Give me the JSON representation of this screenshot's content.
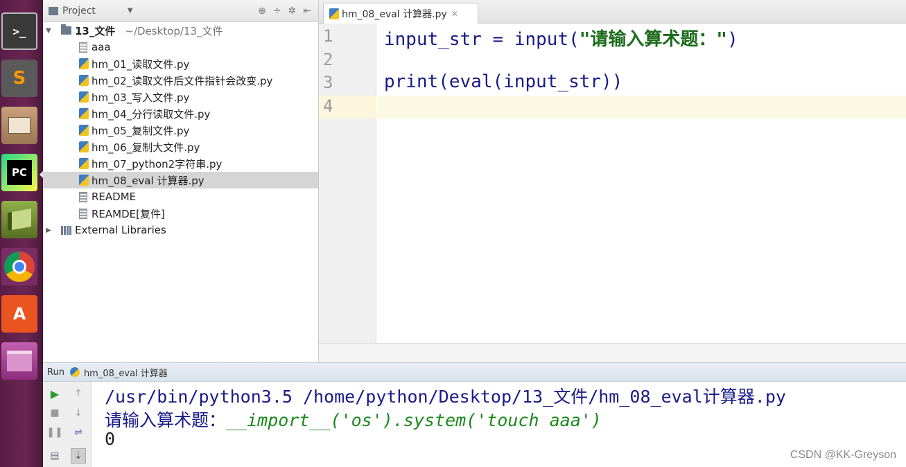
{
  "launcher": {
    "apps": [
      {
        "name": "terminal-icon",
        "glyph": ">_",
        "color": "#2b2b2b"
      },
      {
        "name": "sublime-text-icon",
        "glyph": "S",
        "color": "#4a4a4a"
      },
      {
        "name": "file-manager-icon",
        "glyph": "",
        "color": "#8b6f4e"
      },
      {
        "name": "pycharm-icon",
        "glyph": "PC",
        "color": "#21d789"
      },
      {
        "name": "book-reader-icon",
        "glyph": "",
        "color": "#6f8f2f"
      },
      {
        "name": "chrome-icon",
        "glyph": "",
        "color": "#db4437"
      },
      {
        "name": "software-center-icon",
        "glyph": "A",
        "color": "#e95420"
      },
      {
        "name": "workspace-switcher-icon",
        "glyph": "",
        "color": "#9b3b8b"
      }
    ]
  },
  "project": {
    "header_label": "Project",
    "root": {
      "name": "13_文件",
      "path": "~/Desktop/13_文件"
    },
    "files": [
      {
        "name": "aaa",
        "type": "txt"
      },
      {
        "name": "hm_01_读取文件.py",
        "type": "py"
      },
      {
        "name": "hm_02_读取文件后文件指针会改变.py",
        "type": "py"
      },
      {
        "name": "hm_03_写入文件.py",
        "type": "py"
      },
      {
        "name": "hm_04_分行读取文件.py",
        "type": "py"
      },
      {
        "name": "hm_05_复制文件.py",
        "type": "py"
      },
      {
        "name": "hm_06_复制大文件.py",
        "type": "py"
      },
      {
        "name": "hm_07_python2字符串.py",
        "type": "py"
      },
      {
        "name": "hm_08_eval 计算器.py",
        "type": "py",
        "selected": true
      },
      {
        "name": "README",
        "type": "txt"
      },
      {
        "name": "REAMDE[复件]",
        "type": "txt"
      }
    ],
    "external_libraries": "External Libraries"
  },
  "editor": {
    "tab_label": "hm_08_eval 计算器.py",
    "line_numbers": [
      "1",
      "2",
      "3",
      "4"
    ],
    "line1_code": "input_str = input(",
    "line1_string": "\"请输入算术题：\"",
    "line1_close": ")",
    "line3_code": "print(eval(input_str))"
  },
  "run": {
    "label": "Run",
    "config_name": "hm_08_eval 计算器",
    "command": "/usr/bin/python3.5 /home/python/Desktop/13_文件/hm_08_eval计算器.py",
    "prompt": "请输入算术题：",
    "user_input": "__import__('os').system('touch aaa')",
    "output": "0"
  },
  "watermark": "CSDN @KK-Greyson"
}
